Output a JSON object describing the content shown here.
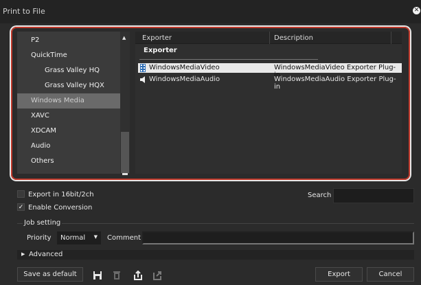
{
  "window": {
    "title": "Print to File",
    "close_glyph": "✕"
  },
  "categories": [
    {
      "label": "P2",
      "indent": 0,
      "selected": false
    },
    {
      "label": "QuickTime",
      "indent": 0,
      "selected": false
    },
    {
      "label": "Grass Valley HQ",
      "indent": 1,
      "selected": false
    },
    {
      "label": "Grass Valley HQX",
      "indent": 1,
      "selected": false
    },
    {
      "label": "Windows Media",
      "indent": 0,
      "selected": true
    },
    {
      "label": "XAVC",
      "indent": 0,
      "selected": false
    },
    {
      "label": "XDCAM",
      "indent": 0,
      "selected": false
    },
    {
      "label": "Audio",
      "indent": 0,
      "selected": false
    },
    {
      "label": "Others",
      "indent": 0,
      "selected": false
    }
  ],
  "exporter_table": {
    "columns": [
      "Exporter",
      "Description"
    ],
    "group_label": "Exporter",
    "rows": [
      {
        "icon": "video-film-icon",
        "name": "WindowsMediaVideo",
        "description": "WindowsMediaVideo Exporter Plug-in",
        "selected": true
      },
      {
        "icon": "speaker-audio-icon",
        "name": "WindowsMediaAudio",
        "description": "WindowsMediaAudio Exporter Plug-in",
        "selected": false
      }
    ]
  },
  "options": {
    "export_16bit_label": "Export in 16bit/2ch",
    "export_16bit_checked": false,
    "enable_conversion_label": "Enable Conversion",
    "enable_conversion_checked": true,
    "check_glyph": "✓",
    "search_label": "Search",
    "search_value": ""
  },
  "job_setting": {
    "title": "Job setting",
    "priority_label": "Priority",
    "priority_value": "Normal",
    "comment_label": "Comment",
    "comment_value": ""
  },
  "advanced": {
    "label": "Advanced",
    "collapsed": true
  },
  "buttons": {
    "save_default": "Save as default",
    "export": "Export",
    "cancel": "Cancel"
  },
  "toolbar_icons": [
    "save-icon",
    "delete-icon",
    "import-icon",
    "export-icon"
  ],
  "colors": {
    "highlight_border": "#c0392b",
    "selected_category": "#6a6a6a",
    "selected_row": "#e9e9e9"
  }
}
